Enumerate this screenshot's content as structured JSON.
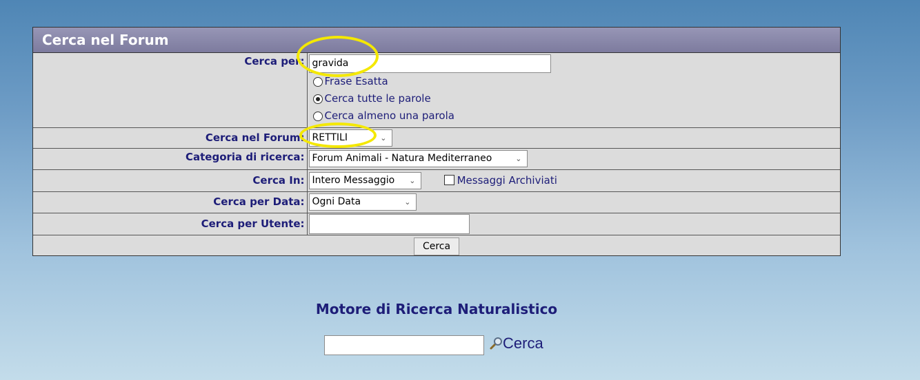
{
  "panel": {
    "title": "Cerca nel Forum"
  },
  "search_for": {
    "label": "Cerca per:",
    "value": "gravida",
    "options": [
      {
        "label": "Frase Esatta",
        "selected": false
      },
      {
        "label": "Cerca tutte le parole",
        "selected": true
      },
      {
        "label": "Cerca almeno una parola",
        "selected": false
      }
    ]
  },
  "forum": {
    "label": "Cerca nel Forum:",
    "selected": "RETTILI"
  },
  "category": {
    "label": "Categoria di ricerca:",
    "selected": "Forum Animali - Natura Mediterraneo"
  },
  "search_in": {
    "label": "Cerca In:",
    "selected": "Intero Messaggio",
    "archived_label": "Messaggi Archiviati",
    "archived_checked": false
  },
  "date": {
    "label": "Cerca per Data:",
    "selected": "Ogni Data"
  },
  "user": {
    "label": "Cerca per Utente:",
    "value": ""
  },
  "submit_label": "Cerca",
  "engine": {
    "title": "Motore di Ricerca Naturalistico",
    "input_value": "",
    "button_label": "Cerca",
    "button_icon": "magnifier-icon"
  },
  "colors": {
    "label_text": "#1d1d78",
    "highlight": "#f4e800",
    "header_bg": "#8a89aa",
    "panel_bg": "#dcdcdc"
  }
}
